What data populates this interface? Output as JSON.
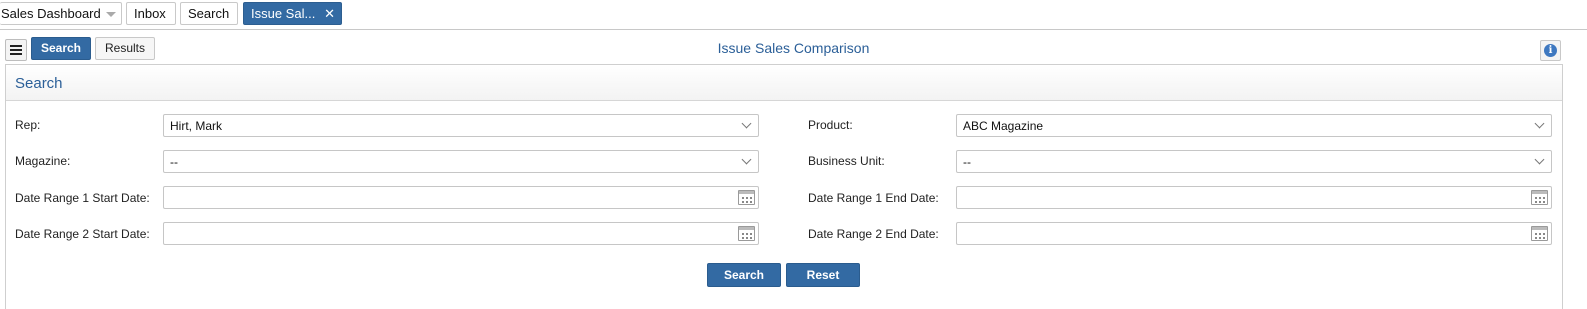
{
  "tabs": [
    {
      "label": "Sales Dashboard"
    },
    {
      "label": "Inbox"
    },
    {
      "label": "Search"
    },
    {
      "label": "Issue Sal..."
    }
  ],
  "toolbar": {
    "search_label": "Search",
    "results_label": "Results",
    "page_title": "Issue Sales Comparison",
    "info_icon": "i"
  },
  "panel": {
    "title": "Search"
  },
  "form": {
    "rep": {
      "label": "Rep:",
      "value": "Hirt, Mark"
    },
    "product": {
      "label": "Product:",
      "value": "ABC Magazine"
    },
    "magazine": {
      "label": "Magazine:",
      "value": "--"
    },
    "business_unit": {
      "label": "Business Unit:",
      "value": "--"
    },
    "dr1_start": {
      "label": "Date Range 1 Start Date:",
      "value": ""
    },
    "dr1_end": {
      "label": "Date Range 1 End Date:",
      "value": ""
    },
    "dr2_start": {
      "label": "Date Range 2 Start Date:",
      "value": ""
    },
    "dr2_end": {
      "label": "Date Range 2 End Date:",
      "value": ""
    }
  },
  "actions": {
    "search_label": "Search",
    "reset_label": "Reset"
  },
  "colors": {
    "accent": "#336aa3",
    "title": "#2b5f98"
  }
}
